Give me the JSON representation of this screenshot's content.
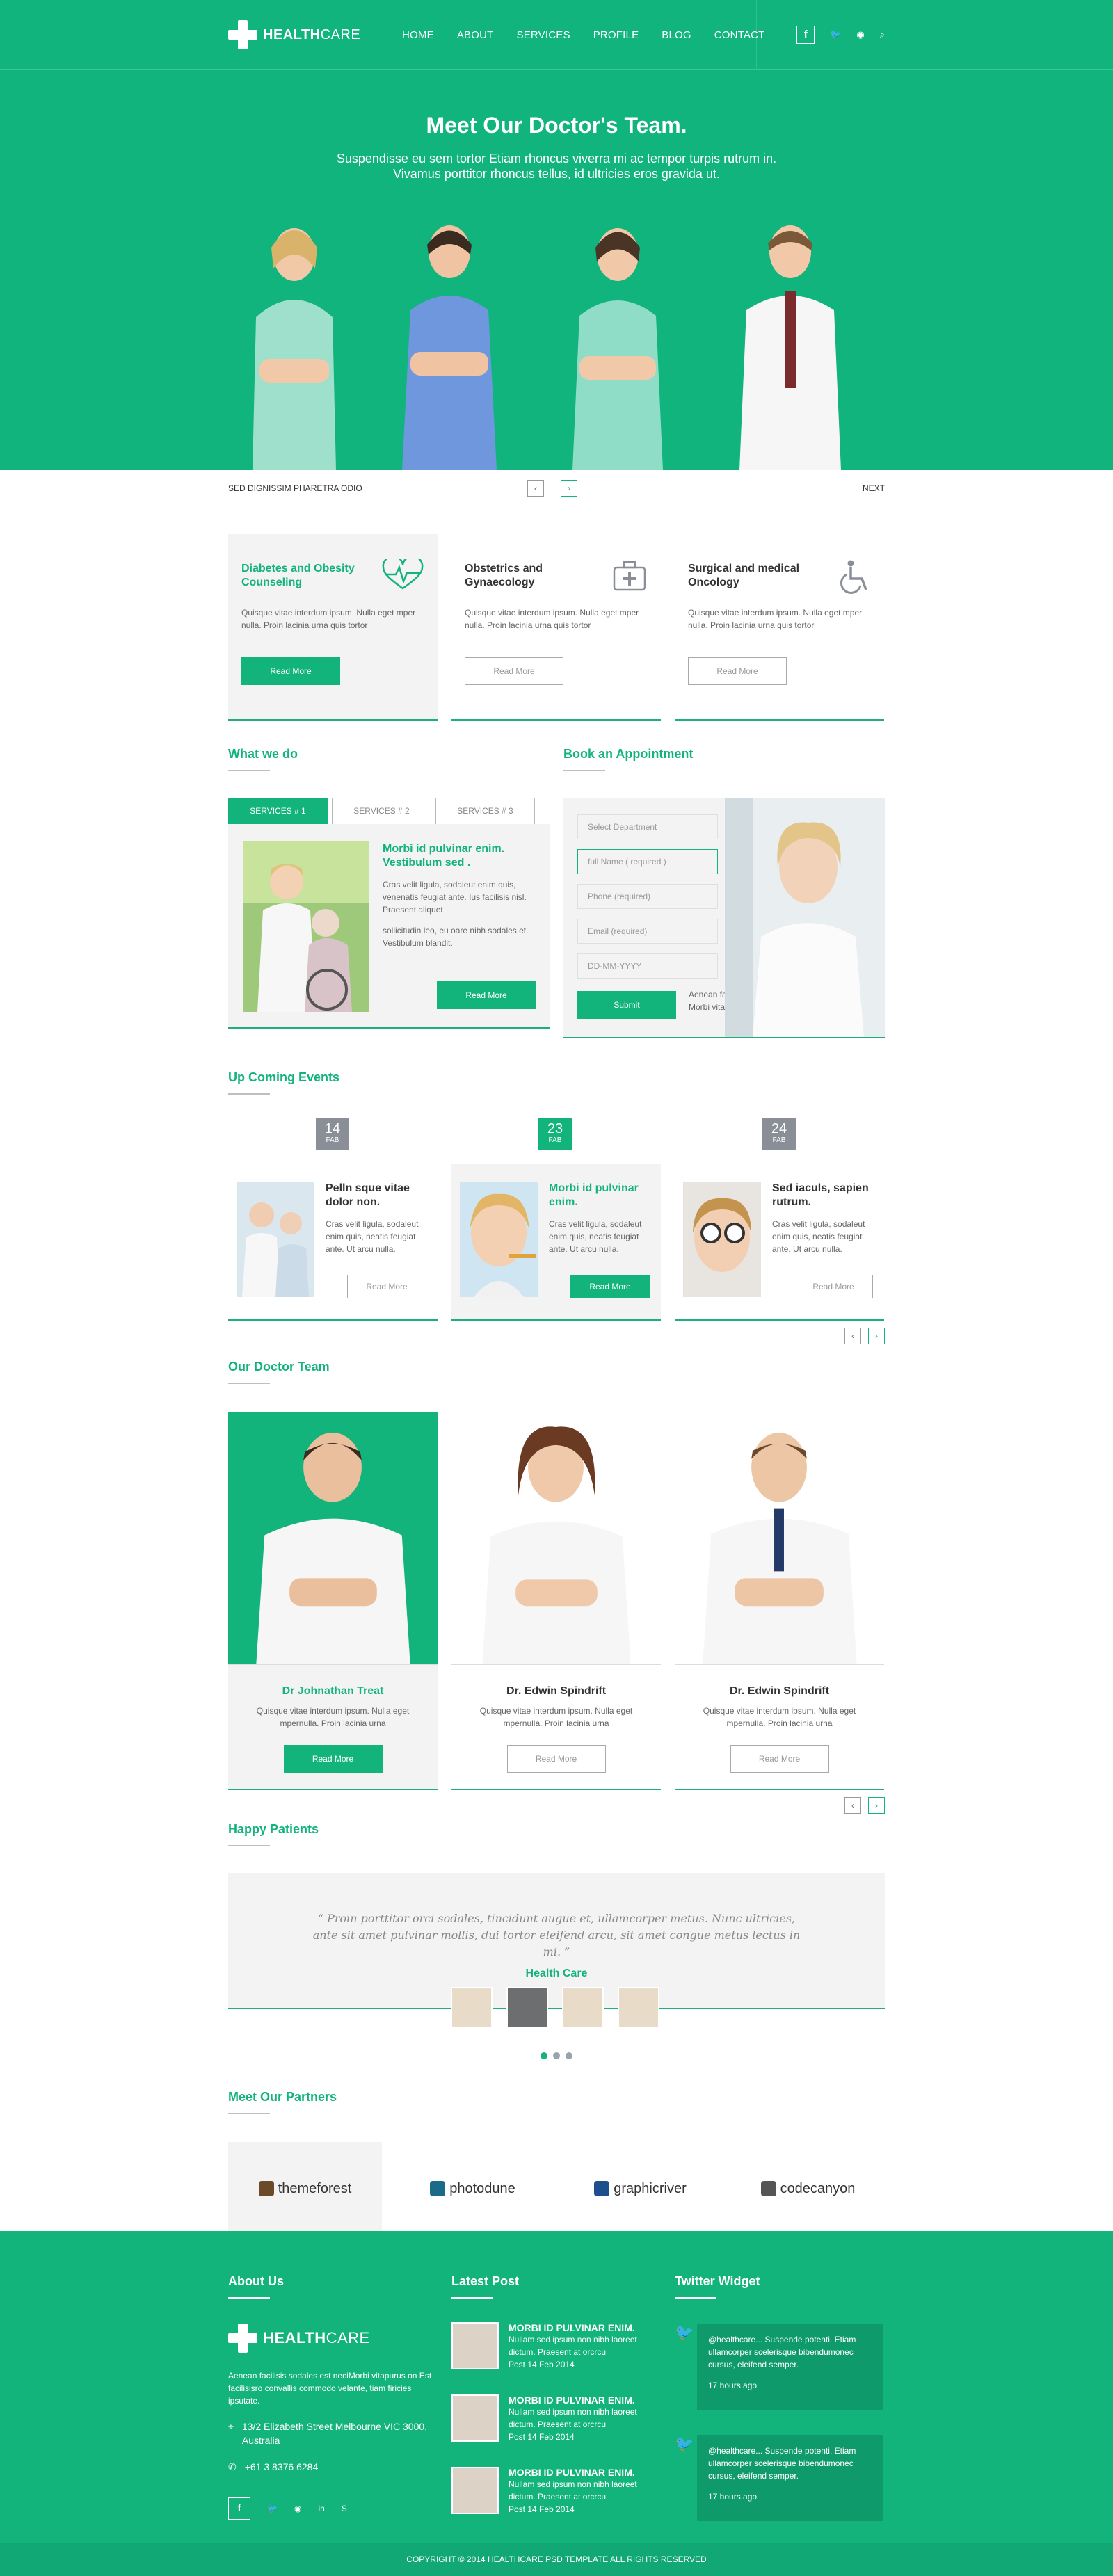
{
  "brand": {
    "name_bold": "HEALTH",
    "name_light": "CARE"
  },
  "nav": [
    "HOME",
    "ABOUT",
    "SERVICES",
    "PROFILE",
    "BLOG",
    "CONTACT"
  ],
  "hero": {
    "title": "Meet Our Doctor's Team.",
    "line1": "Suspendisse eu sem tortor Etiam rhoncus viverra mi ac tempor turpis rutrum in.",
    "line2": "Vivamus porttitor rhoncus tellus, id ultricies eros gravida ut.",
    "slide_caption": "SED DIGNISSIM PHARETRA ODIO",
    "next": "NEXT"
  },
  "services": [
    {
      "title": "Diabetes and Obesity Counseling",
      "text": "Quisque vitae interdum ipsum. Nulla eget mper nulla. Proin lacinia urna quis tortor",
      "button": "Read More"
    },
    {
      "title": "Obstetrics and Gynaecology",
      "text": "Quisque vitae interdum ipsum. Nulla eget mper nulla. Proin lacinia urna quis tortor",
      "button": "Read More"
    },
    {
      "title": "Surgical and medical Oncology",
      "text": "Quisque vitae interdum ipsum. Nulla eget mper nulla. Proin lacinia urna quis tortor",
      "button": "Read More"
    }
  ],
  "what_we_do": {
    "title": "What we do",
    "tabs": [
      "SERVICES # 1",
      "SERVICES # 2",
      "SERVICES # 3"
    ],
    "heading": "Morbi id pulvinar enim. Vestibulum sed .",
    "p1": "Cras velit ligula, sodaleut enim quis, venenatis feugiat ante. Ius facilisis nisl. Praesent aliquet",
    "p2": "sollicitudin leo, eu oare nibh sodales et. Vestibulum blandit.",
    "button": "Read More"
  },
  "appointment": {
    "title": "Book an Appointment",
    "fields": [
      "Select Department",
      "full Name  ( required )",
      "Phone (required)",
      "Email (required)",
      "DD-MM-YYYY"
    ],
    "submit": "Submit",
    "note": "Aenean facilisis sodales est nec gravida. Morbi vitae purus non est facilisis."
  },
  "events": {
    "title": "Up Coming Events",
    "items": [
      {
        "day": "14",
        "month": "FAB",
        "title": "Pelln sque vitae dolor non.",
        "text": "Cras velit ligula, sodaleut enim quis, neatis feugiat ante. Ut arcu nulla.",
        "button": "Read More"
      },
      {
        "day": "23",
        "month": "FAB",
        "title": "Morbi id pulvinar enim.",
        "text": "Cras velit ligula, sodaleut enim quis, neatis feugiat ante. Ut arcu nulla.",
        "button": "Read More"
      },
      {
        "day": "24",
        "month": "FAB",
        "title": "Sed iaculs, sapien rutrum.",
        "text": "Cras velit ligula, sodaleut enim quis, neatis feugiat ante. Ut arcu nulla.",
        "button": "Read More"
      }
    ]
  },
  "doctors": {
    "title": "Our Doctor Team",
    "items": [
      {
        "name": "Dr Johnathan Treat",
        "text": "Quisque vitae interdum ipsum. Nulla eget mpernulla. Proin lacinia urna",
        "button": "Read More"
      },
      {
        "name": "Dr. Edwin Spindrift",
        "text": "Quisque vitae interdum ipsum. Nulla eget mpernulla. Proin lacinia urna",
        "button": "Read More"
      },
      {
        "name": "Dr. Edwin Spindrift",
        "text": "Quisque vitae interdum ipsum. Nulla eget mpernulla. Proin lacinia urna",
        "button": "Read More"
      }
    ]
  },
  "patients": {
    "title": "Happy Patients",
    "quote": "Proin porttitor orci sodales, tincidunt augue et, ullamcorper metus. Nunc ultricies, ante sit amet pulvinar mollis, dui tortor eleifend arcu, sit amet congue metus lectus in mi.",
    "author": "Health Care"
  },
  "partners": {
    "title": "Meet Our Partners",
    "items": [
      "themeforest",
      "photodune",
      "graphicriver",
      "codecanyon"
    ]
  },
  "footer": {
    "about_title": "About Us",
    "about_text": "Aenean facilisis sodales est neciMorbi vitapurus on Est facilisisro convallis commodo velante, tiam firicies ipsutate.",
    "address": "13/2 Elizabeth Street Melbourne VIC 3000, Australia",
    "phone": "+61 3 8376 6284",
    "latest_title": "Latest Post",
    "posts": [
      {
        "title": "MORBI ID PULVINAR ENIM.",
        "text": "Nullam sed ipsum non nibh laoreet dictum. Praesent at orcrcu",
        "date": "Post 14 Feb 2014"
      },
      {
        "title": "MORBI ID PULVINAR ENIM.",
        "text": "Nullam sed ipsum non nibh laoreet dictum. Praesent at orcrcu",
        "date": "Post 14 Feb 2014"
      },
      {
        "title": "MORBI ID PULVINAR ENIM.",
        "text": "Nullam sed ipsum non nibh laoreet dictum. Praesent at orcrcu",
        "date": "Post 14 Feb 2014"
      }
    ],
    "twitter_title": "Twitter Widget",
    "tweets": [
      {
        "text": "@healthcare... Suspende potenti. Etiam ullamcorper scelerisque bibendumonec cursus, eleifend semper.",
        "time": "17 hours ago"
      },
      {
        "text": "@healthcare... Suspende potenti. Etiam ullamcorper scelerisque bibendumonec cursus, eleifend semper.",
        "time": "17 hours ago"
      }
    ],
    "copyright": "COPYRIGHT © 2014 HEALTHCARE PSD TEMPLATE ALL RIGHTS RESERVED"
  },
  "colors": {
    "brand_green": "#13b37c",
    "dark_green": "#0e9a6a",
    "grey_date": "#8a8f97"
  }
}
